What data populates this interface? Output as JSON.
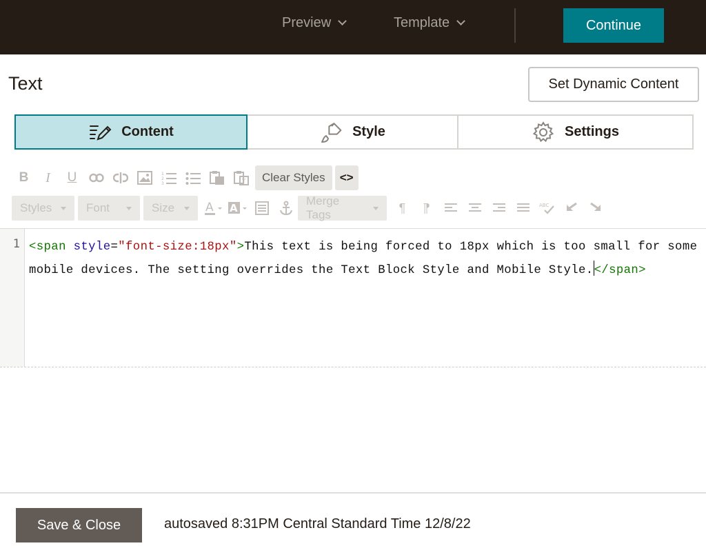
{
  "topbar": {
    "preview_label": "Preview",
    "template_label": "Template",
    "continue_label": "Continue"
  },
  "header": {
    "title": "Text",
    "dynamic_button": "Set Dynamic Content"
  },
  "tabs": [
    {
      "label": "Content",
      "active": true,
      "icon": "pencil-lines-icon"
    },
    {
      "label": "Style",
      "active": false,
      "icon": "paint-brush-icon"
    },
    {
      "label": "Settings",
      "active": false,
      "icon": "gear-icon"
    }
  ],
  "toolbar": {
    "row1_icons": [
      "bold-icon",
      "italic-icon",
      "underline-icon",
      "link-icon",
      "unlink-icon",
      "image-icon",
      "numbered-list-icon",
      "bulleted-list-icon",
      "paste-icon",
      "paste-text-icon"
    ],
    "clear_styles_label": "Clear Styles",
    "source_label": "<>",
    "styles_label": "Styles",
    "font_label": "Font",
    "size_label": "Size",
    "merge_tags_label": "Merge Tags",
    "row2_icons": [
      "text-color-icon",
      "background-color-icon",
      "block-icon",
      "anchor-icon",
      "paragraph-ltr-icon",
      "paragraph-rtl-icon",
      "align-left-icon",
      "align-center-icon",
      "align-right-icon",
      "align-justify-icon",
      "spellcheck-icon",
      "undo-icon",
      "redo-icon"
    ]
  },
  "editor": {
    "line_number": "1",
    "tag_open": "<span",
    "attr_name": " style",
    "attr_eq": "=",
    "attr_value": "\"font-size:18px\"",
    "tag_close_bracket": ">",
    "text": "This text is being forced to 18px which is too small for some mobile devices. The setting overrides the Text Block Style and Mobile Style.",
    "tag_end": "</span>"
  },
  "footer": {
    "save_label": "Save & Close",
    "autosave_text": "autosaved 8:31PM Central Standard Time 12/8/22"
  },
  "colors": {
    "topbar": "#241c15",
    "accent": "#007c89",
    "active_tab": "#bfe3e6",
    "save_button": "#625b56"
  }
}
